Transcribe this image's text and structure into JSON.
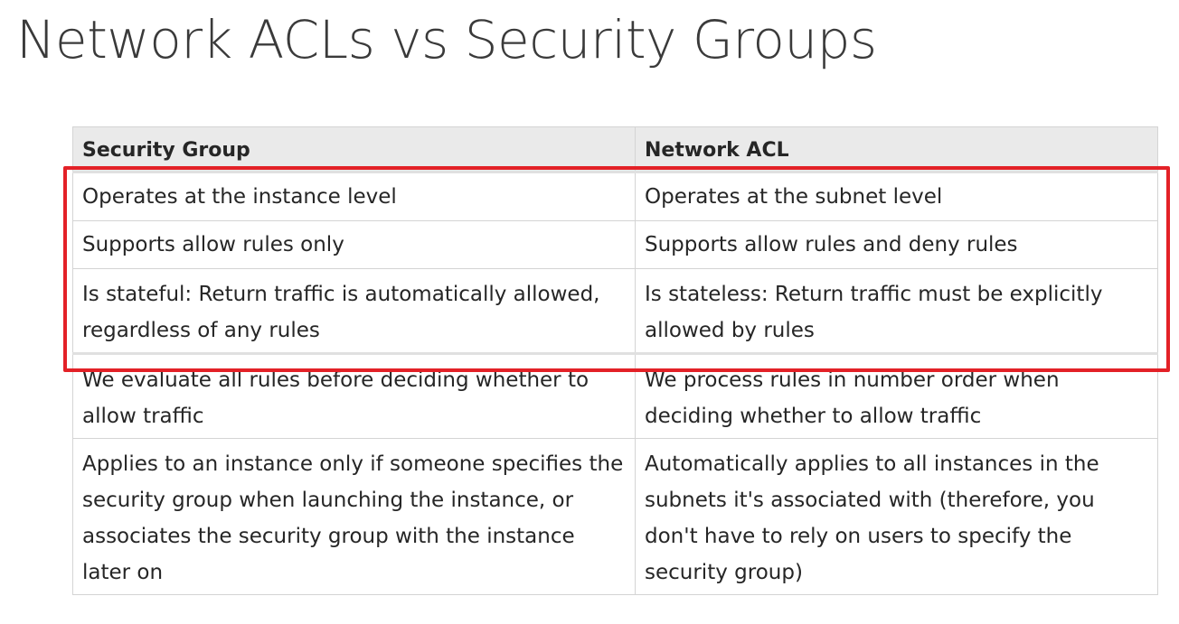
{
  "title": "Network ACLs vs Security Groups",
  "table": {
    "headers": [
      "Security Group",
      "Network ACL"
    ],
    "rows": [
      [
        "Operates at the instance level",
        "Operates at the subnet level"
      ],
      [
        "Supports allow rules only",
        "Supports allow rules and deny rules"
      ],
      [
        "Is stateful: Return traffic is automatically allowed, regardless of any rules",
        "Is stateless: Return traffic must be explicitly allowed by rules"
      ],
      [
        "We evaluate all rules before deciding whether to allow traffic",
        "We process rules in number order when deciding whether to allow traffic"
      ],
      [
        "Applies to an instance only if someone specifies the security group when launching the instance, or associates the security group with the instance later on",
        "Automatically applies to all instances in the subnets it's associated with (therefore, you don't have to rely on users to specify the security group)"
      ]
    ]
  },
  "highlight": {
    "color": "#e32127",
    "covers_rows": [
      1,
      2,
      3
    ]
  }
}
